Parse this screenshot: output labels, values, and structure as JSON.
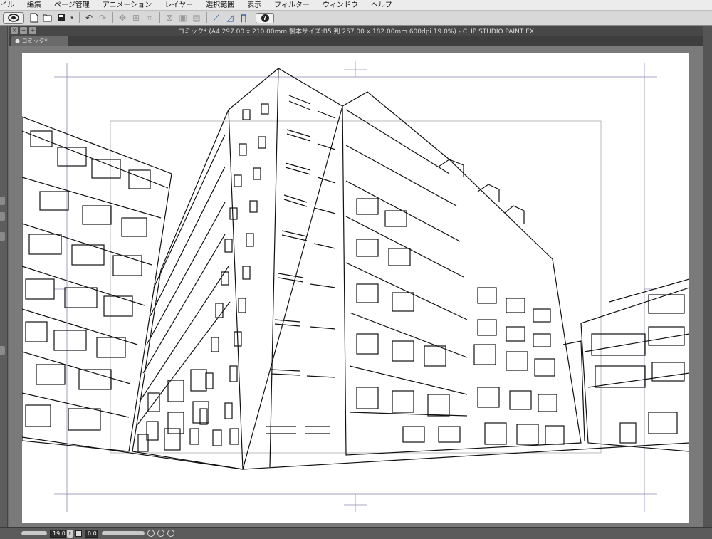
{
  "menubar": {
    "items": [
      "イル",
      "編集",
      "ページ管理",
      "アニメーション",
      "レイヤー",
      "選択範囲",
      "表示",
      "フィルター",
      "ウィンドウ",
      "ヘルプ"
    ]
  },
  "toolbar": {
    "buttons": [
      {
        "name": "new-file-icon"
      },
      {
        "name": "open-file-icon"
      },
      {
        "name": "save-icon"
      },
      {
        "name": "undo-icon"
      },
      {
        "name": "redo-icon"
      },
      {
        "name": "transform-icon"
      },
      {
        "name": "clear-icon"
      },
      {
        "name": "ruler-icon"
      },
      {
        "name": "perspective-icon"
      },
      {
        "name": "snap-icon"
      }
    ],
    "help_label": "?"
  },
  "document": {
    "title": "コミック* (A4 297.00 x 210.00mm 製本サイズ:B5 判 257.00 x 182.00mm 600dpi 19.0%)  - CLIP STUDIO PAINT EX",
    "tab_label": "● コミック*"
  },
  "statusbar": {
    "zoom_value": "19.0",
    "rotation_value": "0.0"
  }
}
